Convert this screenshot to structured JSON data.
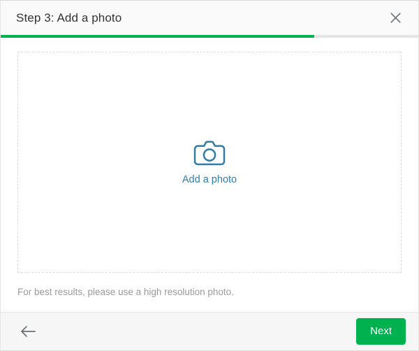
{
  "window": {
    "title": "Step 3: Add a photo"
  },
  "header": {
    "title": "Step 3: Add a photo",
    "close_icon": "close-icon",
    "close_label": "Close"
  },
  "progress": {
    "percent": 75,
    "fill_color": "#00b14f",
    "track_color": "#e4e4e4",
    "step_current": 3,
    "step_total": 4
  },
  "main": {
    "dropzone": {
      "icon": "camera-icon",
      "action_label": "Add a photo",
      "link_color": "#2f7ca9",
      "border_style": "dashed",
      "border_color": "#dcdcdc"
    },
    "helper_text": "For best results, please use a high resolution photo."
  },
  "footer": {
    "back_icon": "arrow-left-icon",
    "back_label": "Back",
    "next_label": "Next",
    "next_color": "#00b14f",
    "background": "#f6f6f6"
  }
}
